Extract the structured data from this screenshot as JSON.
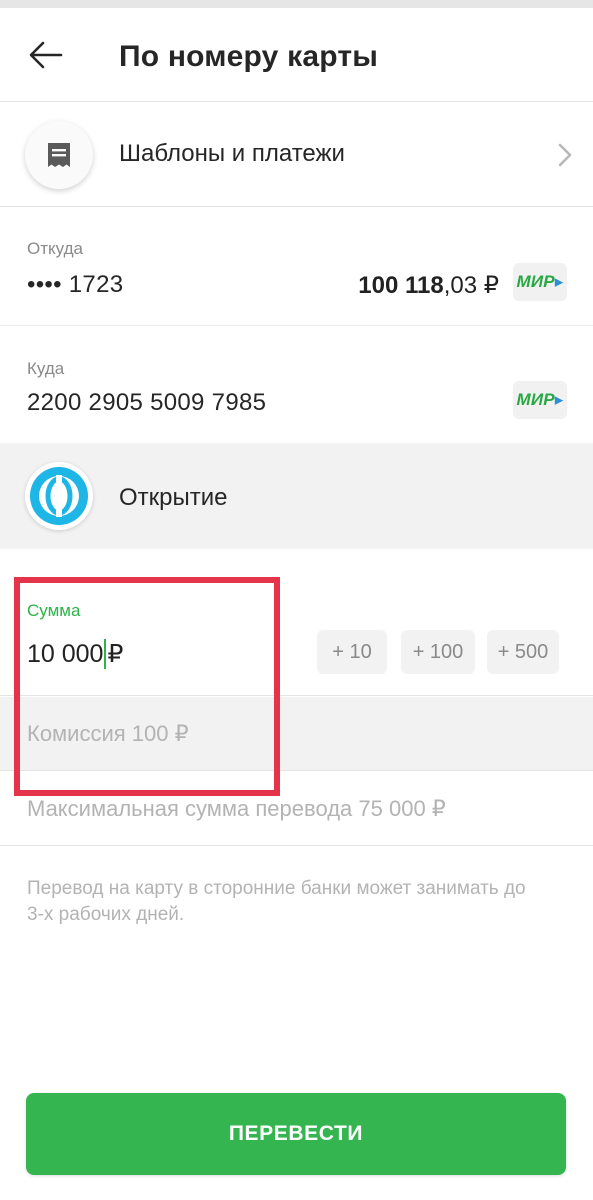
{
  "header": {
    "title": "По номеру карты",
    "back_icon": "arrow-left-icon"
  },
  "templates": {
    "label": "Шаблоны и платежи",
    "icon": "receipt-icon",
    "chevron_icon": "chevron-right-icon"
  },
  "from": {
    "label": "Откуда",
    "card_masked": "•••• 1723",
    "balance_int": "100 118",
    "balance_dec": ",03 ₽",
    "payment_system": "МИР"
  },
  "to": {
    "label": "Куда",
    "card_number": "2200 2905 5009 7985",
    "payment_system": "МИР"
  },
  "bank": {
    "name": "Открытие",
    "logo_icon": "otkritie-logo-icon",
    "logo_color": "#1eb6e6"
  },
  "amount": {
    "label": "Сумма",
    "value": "10 000",
    "currency": "₽",
    "quick_add": [
      "+ 10",
      "+ 100",
      "+ 500"
    ]
  },
  "commission": "Комиссия 100 ₽",
  "max_amount": "Максимальная сумма перевода 75 000 ₽",
  "note": "Перевод на карту в сторонние банки может занимать до 3-х рабочих дней.",
  "submit_label": "ПЕРЕВЕСТИ",
  "colors": {
    "accent_green": "#35b550",
    "label_green": "#2db34a",
    "highlight_red": "#e3344a",
    "mir_green": "#27a843",
    "mir_blue": "#2b8fd8"
  }
}
